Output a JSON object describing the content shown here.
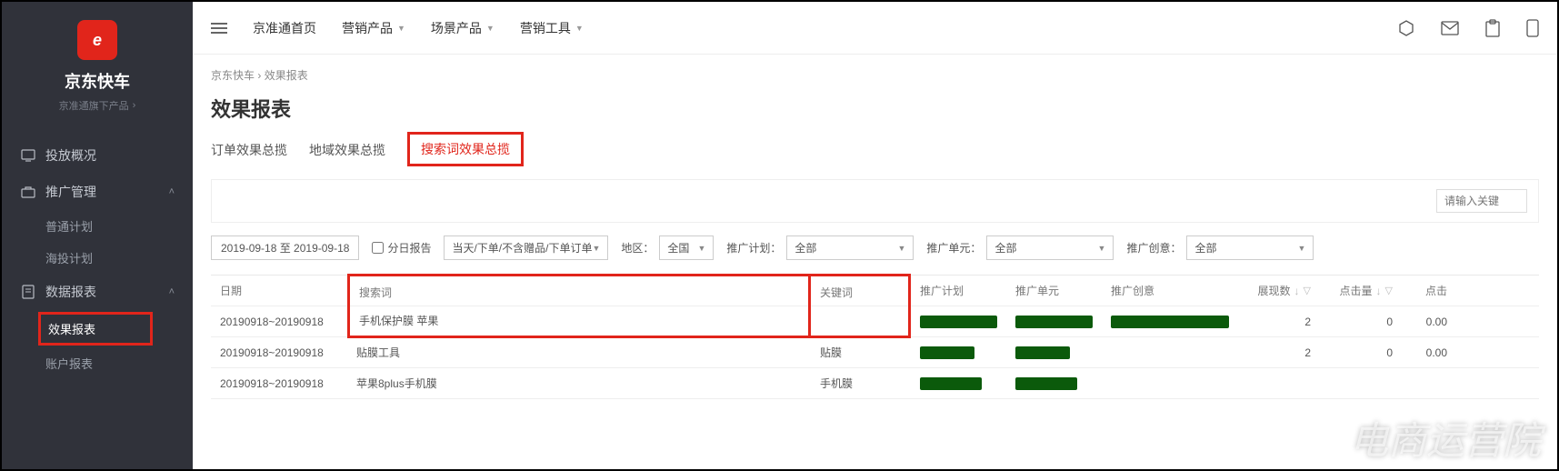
{
  "brand": {
    "name": "京东快车",
    "sub": "京准通旗下产品",
    "logo_glyph": "e"
  },
  "sidebar": {
    "items": [
      {
        "label": "投放概况"
      },
      {
        "label": "推广管理",
        "children": [
          {
            "label": "普通计划"
          },
          {
            "label": "海投计划"
          }
        ]
      },
      {
        "label": "数据报表",
        "children": [
          {
            "label": "效果报表",
            "active": true
          },
          {
            "label": "账户报表"
          }
        ]
      }
    ]
  },
  "topbar": {
    "links": [
      {
        "label": "京准通首页"
      },
      {
        "label": "营销产品",
        "dd": true
      },
      {
        "label": "场景产品",
        "dd": true
      },
      {
        "label": "营销工具",
        "dd": true
      }
    ]
  },
  "breadcrumb": {
    "a": "京东快车",
    "b": "效果报表"
  },
  "page_title": "效果报表",
  "tabs": [
    {
      "label": "订单效果总揽"
    },
    {
      "label": "地域效果总揽"
    },
    {
      "label": "搜索词效果总揽",
      "active": true
    }
  ],
  "search_placeholder": "请输入关键",
  "filters": {
    "date": "2019-09-18 至 2019-09-18",
    "daily_label": "分日报告",
    "scope": "当天/下单/不含赠品/下单订单",
    "region_label": "地区：",
    "region_value": "全国",
    "plan_label": "推广计划：",
    "plan_value": "全部",
    "unit_label": "推广单元：",
    "unit_value": "全部",
    "creative_label": "推广创意：",
    "creative_value": "全部"
  },
  "table": {
    "headers": {
      "date": "日期",
      "search": "搜索词",
      "kw": "关键词",
      "plan": "推广计划",
      "unit": "推广单元",
      "creative": "推广创意",
      "imp": "展现数",
      "clk": "点击量",
      "ctr": "点击"
    },
    "rows": [
      {
        "date": "20190918~20190918",
        "search": "手机保护膜 苹果",
        "kw": "",
        "imp": "2",
        "clk": "0",
        "ctr": "0.00",
        "hl": true
      },
      {
        "date": "20190918~20190918",
        "search": "贴膜工具",
        "kw": "贴膜",
        "imp": "2",
        "clk": "0",
        "ctr": "0.00"
      },
      {
        "date": "20190918~20190918",
        "search": "苹果8plus手机膜",
        "kw": "手机膜",
        "imp": "",
        "clk": "",
        "ctr": ""
      }
    ]
  },
  "watermark": "电商运营院"
}
